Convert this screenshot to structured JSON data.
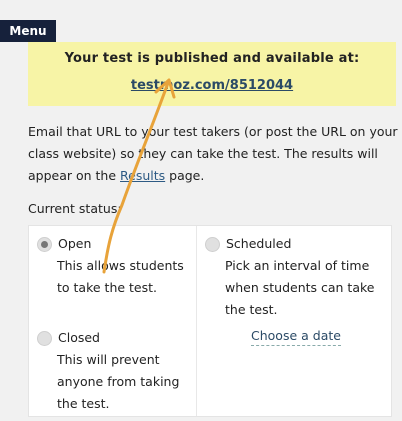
{
  "menu_label": "Menu",
  "banner": {
    "message": "Your test is published and available at:",
    "url": "testmoz.com/8512044"
  },
  "info": {
    "text_before": "Email that URL to your test takers (or post the URL on your class website) so they can take the test. The results will appear on the ",
    "results_link": "Results",
    "text_after": " page."
  },
  "status": {
    "label": "Current status:",
    "open": {
      "label": "Open",
      "desc": "This allows students to take the test.",
      "selected": true
    },
    "scheduled": {
      "label": "Scheduled",
      "desc": "Pick an interval of time when students can take the test.",
      "selected": false
    },
    "closed": {
      "label": "Closed",
      "desc": "This will prevent anyone from taking the test.",
      "selected": false
    },
    "choose_date": "Choose a date"
  },
  "colors": {
    "banner_bg": "#f7f4a6",
    "menu_bg": "#16213b",
    "arrow": "#e8a33a",
    "link": "#2b4a66"
  }
}
